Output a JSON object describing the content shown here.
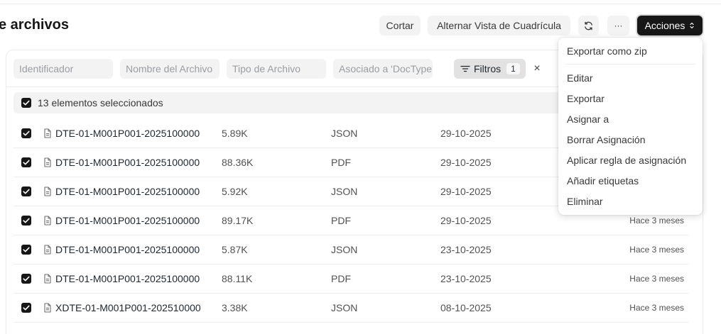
{
  "header": {
    "title": "e archivos",
    "buttons": {
      "cut": "Cortar",
      "toggle_grid": "Alternar Vista de Cuadrícula",
      "refresh_icon": "refresh-icon",
      "more": "···",
      "actions": "Acciones"
    }
  },
  "filters": {
    "id_placeholder": "Identificador",
    "name_placeholder": "Nombre del Archivo",
    "type_placeholder": "Tipo de Archivo",
    "assoc_placeholder": "Asociado a 'DocType'",
    "filter_label": "Filtros",
    "filter_count": "1",
    "clear": "×"
  },
  "selection": {
    "text": "13 elementos seleccionados"
  },
  "rows": [
    {
      "name": "DTE-01-M001P001-2025100000",
      "size": "5.89K",
      "type": "JSON",
      "date": "29-10-2025",
      "ago": ""
    },
    {
      "name": "DTE-01-M001P001-2025100000",
      "size": "88.36K",
      "type": "PDF",
      "date": "29-10-2025",
      "ago": ""
    },
    {
      "name": "DTE-01-M001P001-2025100000",
      "size": "5.92K",
      "type": "JSON",
      "date": "29-10-2025",
      "ago": ""
    },
    {
      "name": "DTE-01-M001P001-2025100000",
      "size": "89.17K",
      "type": "PDF",
      "date": "29-10-2025",
      "ago": "Hace 3 meses"
    },
    {
      "name": "DTE-01-M001P001-2025100000",
      "size": "5.87K",
      "type": "JSON",
      "date": "23-10-2025",
      "ago": "Hace 3 meses"
    },
    {
      "name": "DTE-01-M001P001-2025100000",
      "size": "88.11K",
      "type": "PDF",
      "date": "23-10-2025",
      "ago": "Hace 3 meses"
    },
    {
      "name": "XDTE-01-M001P001-202510000",
      "size": "3.38K",
      "type": "JSON",
      "date": "08-10-2025",
      "ago": "Hace 3 meses"
    }
  ],
  "menu": {
    "items": [
      "Exportar como zip",
      "Editar",
      "Exportar",
      "Asignar a",
      "Borrar Asignación",
      "Aplicar regla de asignación",
      "Añadir etiquetas",
      "Eliminar"
    ]
  },
  "colors": {
    "primary_button": "#171717",
    "input_bg": "#f3f3f3",
    "filter_active_bg": "#e2e2e2"
  }
}
